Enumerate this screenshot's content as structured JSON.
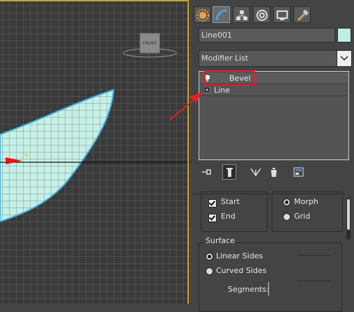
{
  "viewport": {
    "label": "Front viewport",
    "cube_label": "FRONT",
    "shape_fill": "#c6efe6",
    "shape_outline": "#3ab4e8",
    "grid_color": "#636363",
    "background": "#3a3a3a"
  },
  "command_panel": {
    "tabs": [
      {
        "name": "create-tab",
        "icon": "sun-icon"
      },
      {
        "name": "modify-tab",
        "icon": "modify-icon",
        "active": true
      },
      {
        "name": "hierarchy-tab",
        "icon": "hierarchy-icon"
      },
      {
        "name": "motion-tab",
        "icon": "motion-icon"
      },
      {
        "name": "display-tab",
        "icon": "display-icon"
      },
      {
        "name": "utilities-tab",
        "icon": "hammer-icon"
      }
    ],
    "object_name": "Line001",
    "object_color": "#bfece3",
    "modifier_list_label": "Modifier List",
    "stack": [
      {
        "label": "Bevel",
        "icon": "lightbulb-icon"
      },
      {
        "label": "Line",
        "icon": "expand-icon"
      }
    ],
    "stack_toolbar": [
      "pin-stack-icon",
      "show-end-result-icon",
      "make-unique-icon",
      "remove-modifier-icon",
      "configure-modifier-sets-icon"
    ]
  },
  "rollout": {
    "capping": {
      "start_label": "Start",
      "end_label": "End",
      "start_checked": true,
      "end_checked": true,
      "morph_label": "Morph",
      "grid_label": "Grid",
      "morph_selected": true
    },
    "surface": {
      "title": "Surface",
      "linear_sides_label": "Linear Sides",
      "curved_sides_label": "Curved Sides",
      "linear_selected": true,
      "segments_label": "Segments:"
    }
  },
  "annotation": {
    "highlight_color": "#e21f25"
  }
}
